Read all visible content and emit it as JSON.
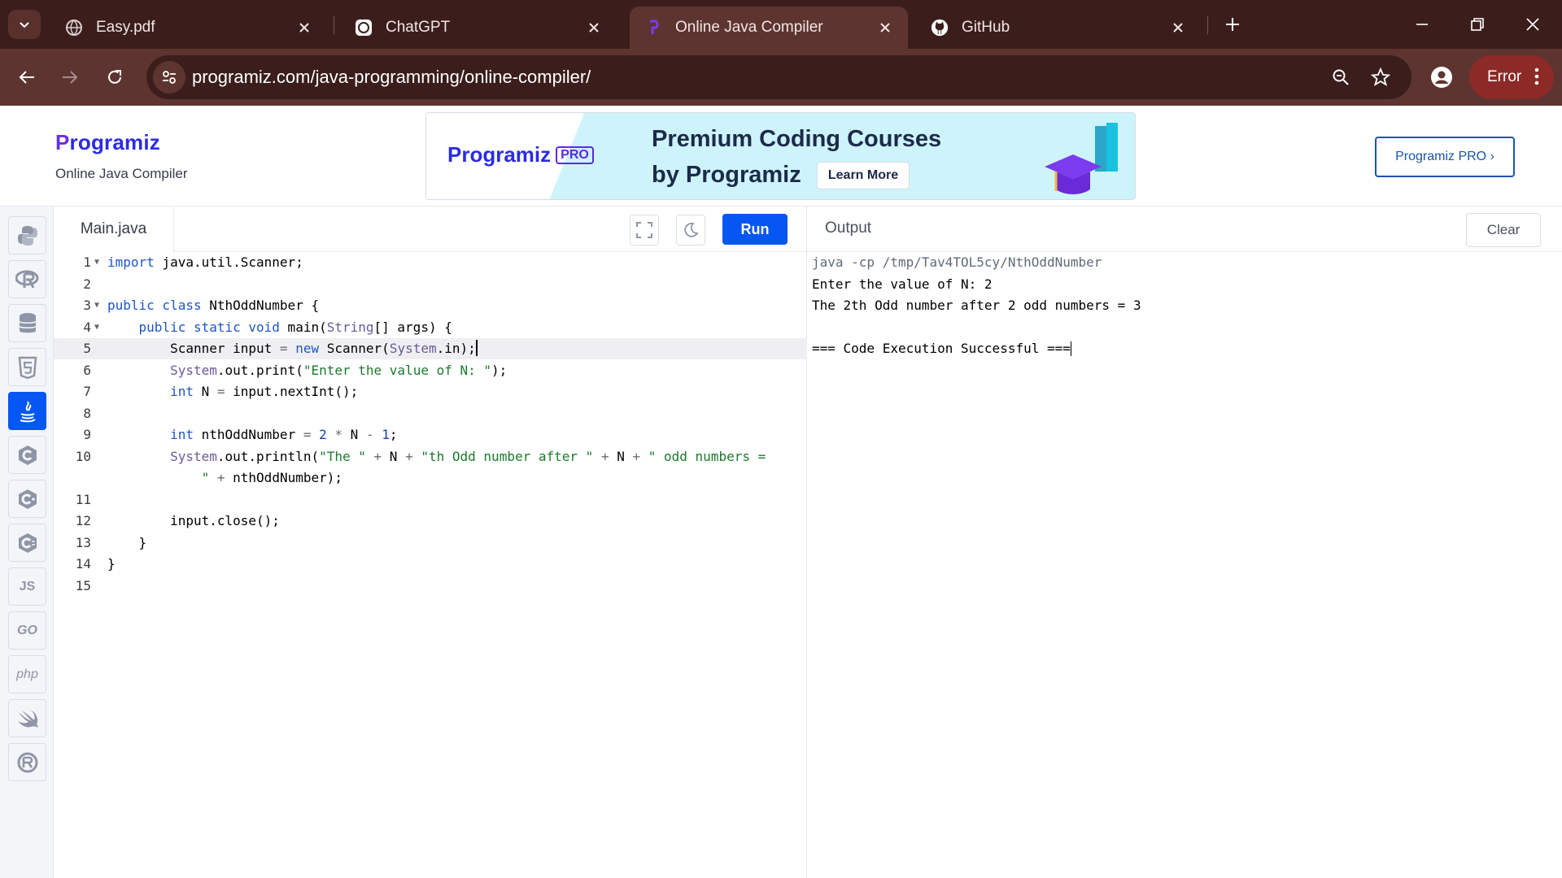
{
  "browser": {
    "tabs": [
      {
        "title": "Easy.pdf",
        "icon": "globe-icon",
        "active": false
      },
      {
        "title": "ChatGPT",
        "icon": "chatgpt-icon",
        "active": false
      },
      {
        "title": "Online Java Compiler",
        "icon": "programiz-icon",
        "active": true
      },
      {
        "title": "GitHub",
        "icon": "github-icon",
        "active": false
      }
    ],
    "url": "programiz.com/java-programming/online-compiler/",
    "error_label": "Error"
  },
  "header": {
    "logo_text": "rogramiz",
    "logo_mark": "P",
    "subtitle": "Online Java Compiler",
    "banner": {
      "logo_text": "Programiz",
      "pro_badge": "PRO",
      "title_line1": "Premium Coding Courses",
      "title_line2": "by Programiz",
      "cta": "Learn More"
    },
    "pro_button": "Programiz PRO ›"
  },
  "sidebar": {
    "languages": [
      {
        "name": "python",
        "glyph": "",
        "active": false
      },
      {
        "name": "r",
        "glyph": "R",
        "active": false
      },
      {
        "name": "sql",
        "glyph": "",
        "active": false
      },
      {
        "name": "html",
        "glyph": "5",
        "active": false
      },
      {
        "name": "java",
        "glyph": "",
        "active": true
      },
      {
        "name": "c",
        "glyph": "C",
        "active": false
      },
      {
        "name": "cpp",
        "glyph": "C",
        "active": false
      },
      {
        "name": "csharp",
        "glyph": "C",
        "active": false
      },
      {
        "name": "js",
        "glyph": "JS",
        "active": false
      },
      {
        "name": "go",
        "glyph": "GO",
        "active": false
      },
      {
        "name": "php",
        "glyph": "php",
        "active": false
      },
      {
        "name": "swift",
        "glyph": "",
        "active": false
      },
      {
        "name": "rust",
        "glyph": "R",
        "active": false
      }
    ]
  },
  "editor": {
    "filename": "Main.java",
    "run_label": "Run",
    "current_line": 5,
    "line_numbers": [
      "1",
      "2",
      "3",
      "4",
      "5",
      "6",
      "7",
      "8",
      "9",
      "10",
      "",
      "11",
      "12",
      "13",
      "14",
      "15"
    ]
  },
  "output": {
    "title": "Output",
    "clear_label": "Clear",
    "lines": [
      "java -cp /tmp/Tav4TOL5cy/NthOddNumber",
      "Enter the value of N: 2",
      "The 2th Odd number after 2 odd numbers = 3",
      "",
      "=== Code Execution Successful ==="
    ]
  },
  "colors": {
    "accent": "#0556f3",
    "tabstrip": "#3b1e1c",
    "toolbar": "#5e3430",
    "brand": "#2b2ce3"
  }
}
